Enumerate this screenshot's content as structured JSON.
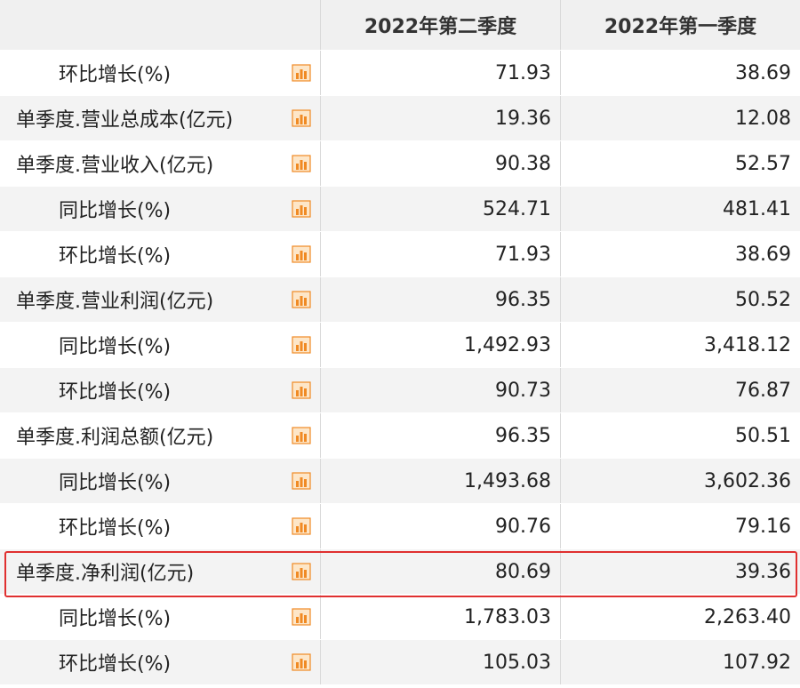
{
  "header": {
    "label": "",
    "col_q2": "2022年第二季度",
    "col_q1": "2022年第一季度"
  },
  "icon": {
    "name": "bar-chart-icon",
    "color": "#f08a24"
  },
  "highlight_color": "#e03030",
  "rows": [
    {
      "label": "环比增长(%)",
      "q2": "71.93",
      "q1": "38.69",
      "indent": true
    },
    {
      "label": "单季度.营业总成本(亿元)",
      "q2": "19.36",
      "q1": "12.08",
      "indent": false
    },
    {
      "label": "单季度.营业收入(亿元)",
      "q2": "90.38",
      "q1": "52.57",
      "indent": false
    },
    {
      "label": "同比增长(%)",
      "q2": "524.71",
      "q1": "481.41",
      "indent": true
    },
    {
      "label": "环比增长(%)",
      "q2": "71.93",
      "q1": "38.69",
      "indent": true
    },
    {
      "label": "单季度.营业利润(亿元)",
      "q2": "96.35",
      "q1": "50.52",
      "indent": false
    },
    {
      "label": "同比增长(%)",
      "q2": "1,492.93",
      "q1": "3,418.12",
      "indent": true
    },
    {
      "label": "环比增长(%)",
      "q2": "90.73",
      "q1": "76.87",
      "indent": true
    },
    {
      "label": "单季度.利润总额(亿元)",
      "q2": "96.35",
      "q1": "50.51",
      "indent": false
    },
    {
      "label": "同比增长(%)",
      "q2": "1,493.68",
      "q1": "3,602.36",
      "indent": true
    },
    {
      "label": "环比增长(%)",
      "q2": "90.76",
      "q1": "79.16",
      "indent": true
    },
    {
      "label": "单季度.净利润(亿元)",
      "q2": "80.69",
      "q1": "39.36",
      "indent": false,
      "highlighted": true
    },
    {
      "label": "同比增长(%)",
      "q2": "1,783.03",
      "q1": "2,263.40",
      "indent": true
    },
    {
      "label": "环比增长(%)",
      "q2": "105.03",
      "q1": "107.92",
      "indent": true
    }
  ]
}
